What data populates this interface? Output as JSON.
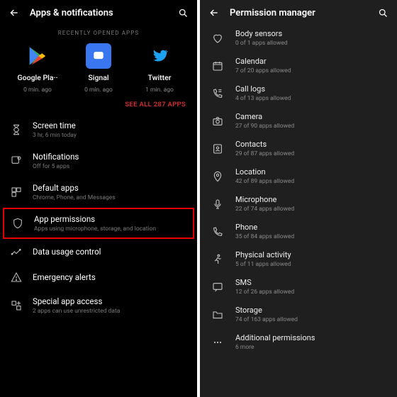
{
  "left": {
    "title": "Apps & notifications",
    "section_label": "RECENTLY OPENED APPS",
    "recent": [
      {
        "name": "Google Pla··",
        "sub": "0 min. ago"
      },
      {
        "name": "Signal",
        "sub": "0 min. ago"
      },
      {
        "name": "Twitter",
        "sub": "1 min. ago"
      }
    ],
    "see_all": "SEE ALL 287 APPS",
    "items": [
      {
        "label": "Screen time",
        "sub": "3 hr, 6 min today"
      },
      {
        "label": "Notifications",
        "sub": "Off for 5 apps"
      },
      {
        "label": "Default apps",
        "sub": "Chrome, Phone, and Messages"
      },
      {
        "label": "App permissions",
        "sub": "Apps using microphone, storage, and location"
      },
      {
        "label": "Data usage control",
        "sub": ""
      },
      {
        "label": "Emergency alerts",
        "sub": ""
      },
      {
        "label": "Special app access",
        "sub": "2 apps can use unrestricted data"
      }
    ]
  },
  "right": {
    "title": "Permission manager",
    "items": [
      {
        "label": "Body sensors",
        "sub": "0 of 1 apps allowed"
      },
      {
        "label": "Calendar",
        "sub": "7 of 20 apps allowed"
      },
      {
        "label": "Call logs",
        "sub": "4 of 13 apps allowed"
      },
      {
        "label": "Camera",
        "sub": "27 of 90 apps allowed"
      },
      {
        "label": "Contacts",
        "sub": "29 of 87 apps allowed"
      },
      {
        "label": "Location",
        "sub": "42 of 89 apps allowed"
      },
      {
        "label": "Microphone",
        "sub": "22 of 74 apps allowed"
      },
      {
        "label": "Phone",
        "sub": "35 of 84 apps allowed"
      },
      {
        "label": "Physical activity",
        "sub": "5 of 11 apps allowed"
      },
      {
        "label": "SMS",
        "sub": "12 of 26 apps allowed"
      },
      {
        "label": "Storage",
        "sub": "74 of 163 apps allowed"
      },
      {
        "label": "Additional permissions",
        "sub": "6 more"
      }
    ]
  },
  "colors": {
    "accent_red": "#d62e2e",
    "highlight_border": "#e40000"
  }
}
